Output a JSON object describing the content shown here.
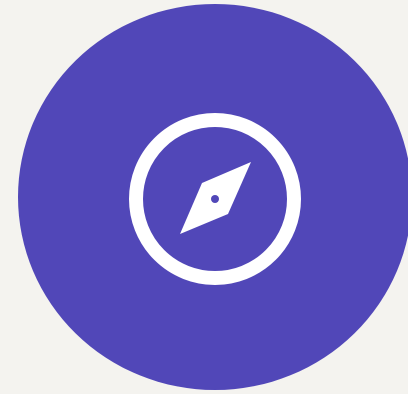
{
  "background_color": "#f4f3ef",
  "accent_color": "#5147b8",
  "icon_color": "#ffffff",
  "icon": {
    "name": "compass-icon"
  }
}
